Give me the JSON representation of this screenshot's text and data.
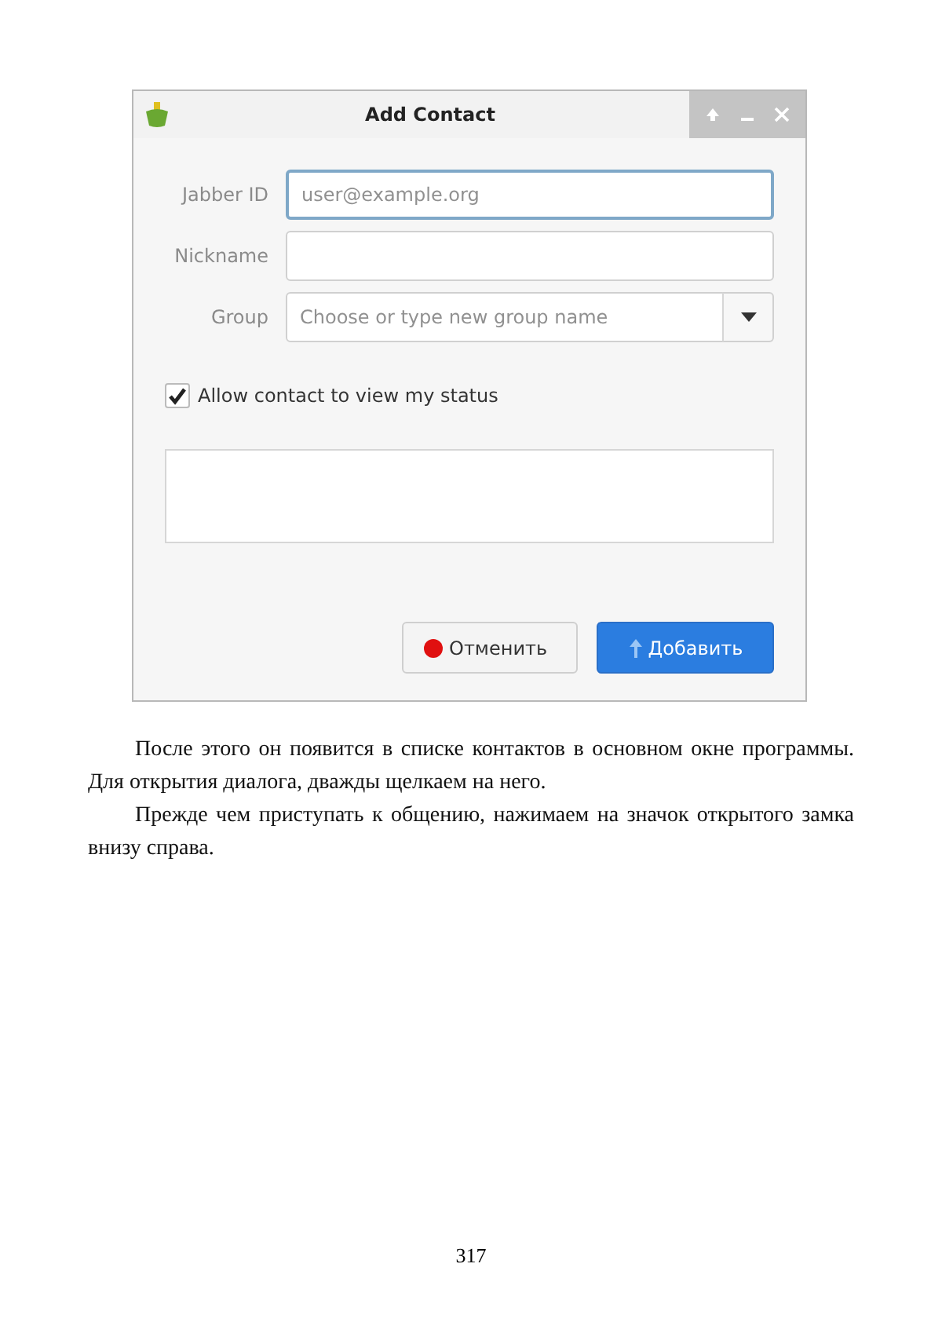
{
  "window": {
    "title": "Add Contact"
  },
  "fields": [
    {
      "label": "Jabber ID",
      "kind": "text",
      "placeholder": "user@example.org",
      "focused": true
    },
    {
      "label": "Nickname",
      "kind": "text",
      "focused": false
    },
    {
      "label": "Group",
      "kind": "combo",
      "placeholder": "Choose or type new group name",
      "focused": false
    }
  ],
  "checkbox": {
    "label": "Allow contact to view my status",
    "checked": true
  },
  "buttons": [
    {
      "label": "Отменить",
      "kind": "cancel"
    },
    {
      "label": "Добавить",
      "kind": "default"
    }
  ],
  "paragraphs": [
    "После этого он появится в списке контактов в основном окне программы. Для открытия диалога, дважды щелкаем на него.",
    "Прежде чем приступать к общению, нажимаем на значок открытого замка внизу справа."
  ],
  "page_number": "317"
}
